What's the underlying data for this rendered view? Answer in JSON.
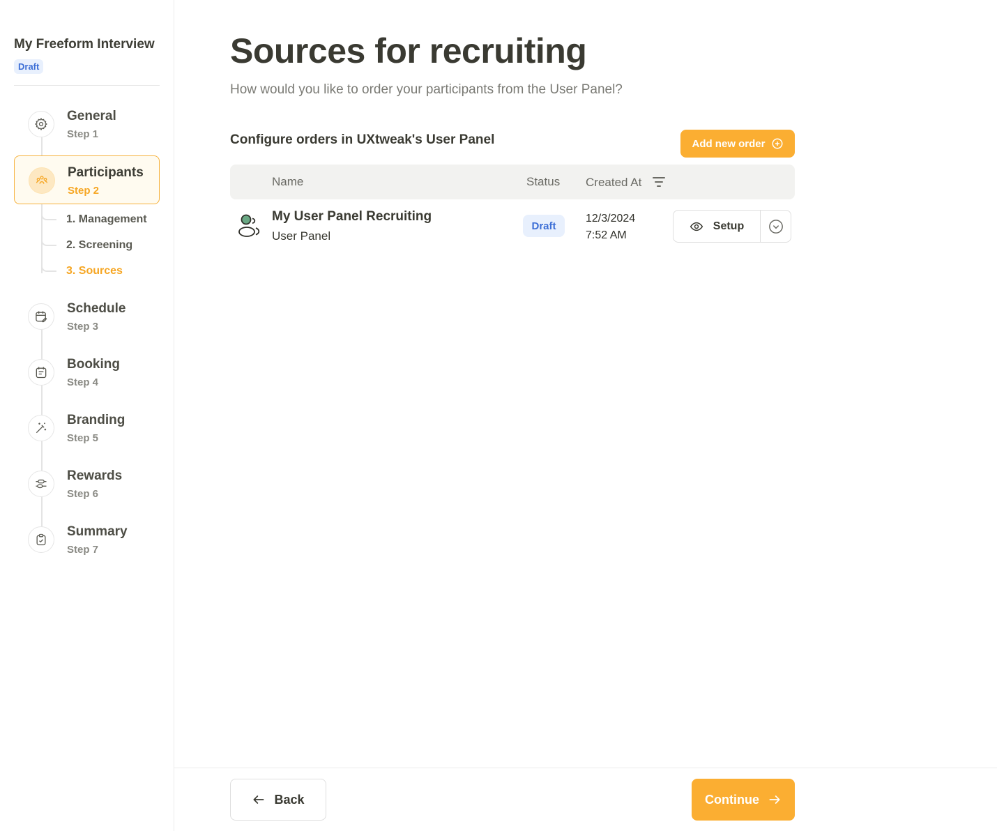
{
  "project": {
    "title": "My Freeform Interview",
    "status": "Draft"
  },
  "steps": [
    {
      "name": "General",
      "sub": "Step 1",
      "icon": "gear-icon"
    },
    {
      "name": "Participants",
      "sub": "Step 2",
      "icon": "participants-icon"
    },
    {
      "name": "Schedule",
      "sub": "Step 3",
      "icon": "calendar-edit-icon"
    },
    {
      "name": "Booking",
      "sub": "Step 4",
      "icon": "calendar-icon"
    },
    {
      "name": "Branding",
      "sub": "Step 5",
      "icon": "magic-wand-icon"
    },
    {
      "name": "Rewards",
      "sub": "Step 6",
      "icon": "sliders-icon"
    },
    {
      "name": "Summary",
      "sub": "Step 7",
      "icon": "clipboard-check-icon"
    }
  ],
  "substeps": [
    "1. Management",
    "2. Screening",
    "3. Sources"
  ],
  "main": {
    "title": "Sources for recruiting",
    "subtitle": "How would you like to order your participants from the User Panel?",
    "section_title": "Configure orders in UXtweak's User Panel",
    "add_button": "Add new order"
  },
  "table": {
    "columns": {
      "name": "Name",
      "status": "Status",
      "created": "Created At"
    },
    "rows": [
      {
        "name": "My User Panel Recruiting",
        "type": "User Panel",
        "status": "Draft",
        "date": "12/3/2024",
        "time": "7:52 AM",
        "action": "Setup"
      }
    ]
  },
  "footer": {
    "back": "Back",
    "continue": "Continue"
  },
  "colors": {
    "accent": "#fbae32",
    "draft_badge": "#3d6fd6",
    "text": "#3a3a32"
  }
}
